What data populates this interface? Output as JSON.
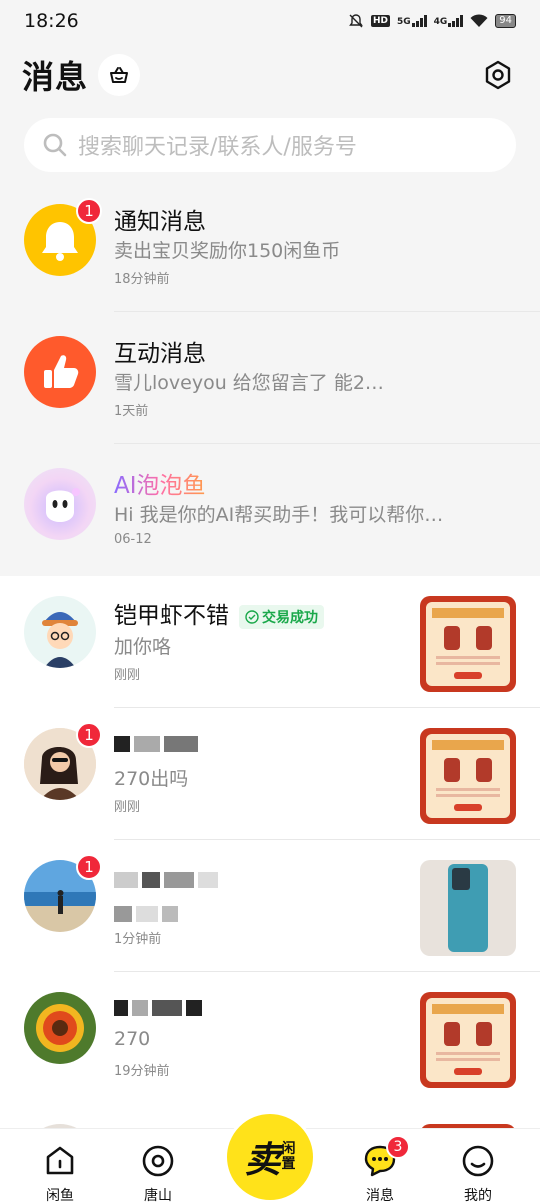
{
  "status_bar": {
    "time": "18:26",
    "hd_label": "HD",
    "net1": "5G",
    "net2": "4G",
    "battery": "94"
  },
  "header": {
    "title": "消息"
  },
  "search": {
    "placeholder": "搜索聊天记录/联系人/服务号"
  },
  "system_rows": [
    {
      "title": "通知消息",
      "subtitle": "卖出宝贝奖励你150闲鱼币",
      "time": "18分钟前",
      "badge": "1"
    },
    {
      "title": "互动消息",
      "subtitle": "雪儿loveyou 给您留言了 能2…",
      "time": "1天前"
    },
    {
      "title": "AI泡泡鱼",
      "subtitle": "Hi 我是你的AI帮买助手！我可以帮你…",
      "time": "06-12"
    }
  ],
  "chats": [
    {
      "name": "铠甲虾不错",
      "tag": "交易成功",
      "message": "加你咯",
      "time": "刚刚"
    },
    {
      "name": "",
      "message": "270出吗",
      "time": "刚刚",
      "badge": "1"
    },
    {
      "name": "",
      "message": "",
      "time": "1分钟前",
      "badge": "1"
    },
    {
      "name": "",
      "message": "270",
      "time": "19分钟前"
    }
  ],
  "bottom_nav": {
    "items": [
      {
        "label": "闲鱼"
      },
      {
        "label": "唐山"
      },
      {
        "label": "消息",
        "badge": "3"
      },
      {
        "label": "我的"
      }
    ],
    "sell_main": "卖",
    "sell_sub1": "闲",
    "sell_sub2": "置"
  },
  "colors": {
    "accent_yellow": "#ffe21a",
    "badge_red": "#f0283a",
    "trade_green": "#1aa84a",
    "bell_yellow": "#ffc400",
    "like_orange": "#ff5a2c"
  }
}
